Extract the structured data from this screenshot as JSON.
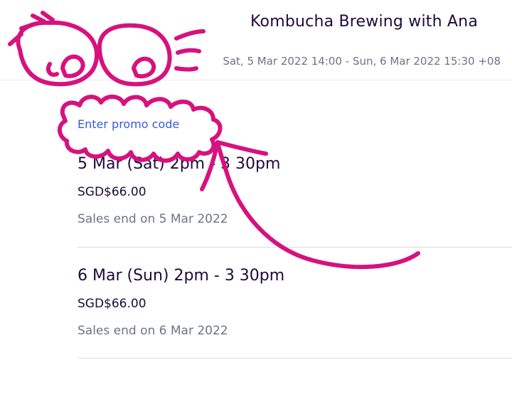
{
  "header": {
    "title": "Kombucha Brewing with Ana",
    "dates": "Sat, 5 Mar 2022 14:00 - Sun, 6 Mar 2022 15:30 +08"
  },
  "promo": {
    "link_label": "Enter promo code"
  },
  "tickets": [
    {
      "name": "5 Mar (Sat) 2pm - 3 30pm",
      "price": "SGD$66.00",
      "sales_end": "Sales end on 5 Mar 2022"
    },
    {
      "name": "6 Mar (Sun) 2pm - 3 30pm",
      "price": "SGD$66.00",
      "sales_end": "Sales end on 6 Mar 2022"
    }
  ],
  "colors": {
    "title": "#1e0a3c",
    "muted": "#6f7287",
    "link": "#3659e3",
    "annotation": "#d6127e"
  },
  "annotation": {
    "type": "hand-drawn-doodle",
    "icon": "eyes-and-arrow-pointing-to-promo-code"
  }
}
